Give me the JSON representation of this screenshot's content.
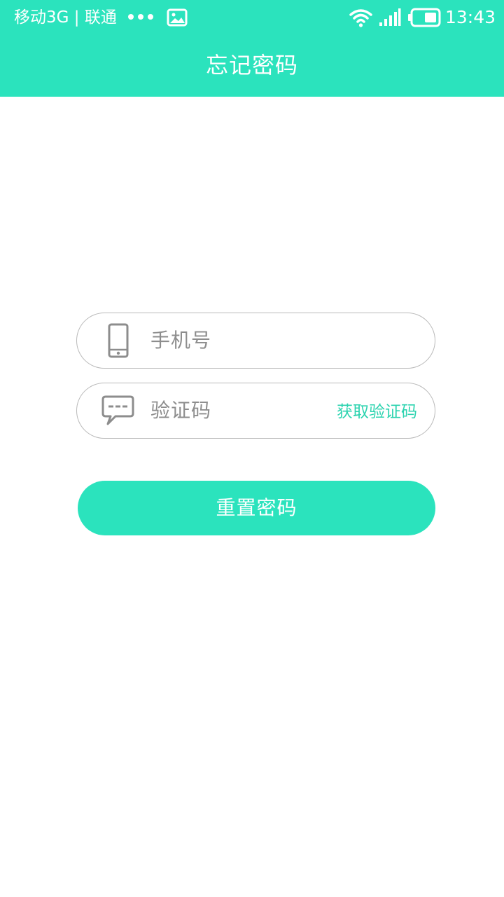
{
  "status_bar": {
    "carrier": "移动3G | 联通",
    "time": "13:43"
  },
  "header": {
    "title": "忘记密码"
  },
  "form": {
    "phone_placeholder": "手机号",
    "code_placeholder": "验证码",
    "get_code_label": "获取验证码",
    "submit_label": "重置密码"
  },
  "icons": {
    "phone": "phone-icon",
    "message": "chat-bubble-icon",
    "image": "image-icon",
    "wifi": "wifi-icon",
    "signal": "signal-icon",
    "battery": "battery-icon"
  },
  "colors": {
    "accent": "#2be3bd",
    "link": "#2bd3af",
    "placeholder": "#8d8d8d",
    "border": "#b9b9b9"
  }
}
